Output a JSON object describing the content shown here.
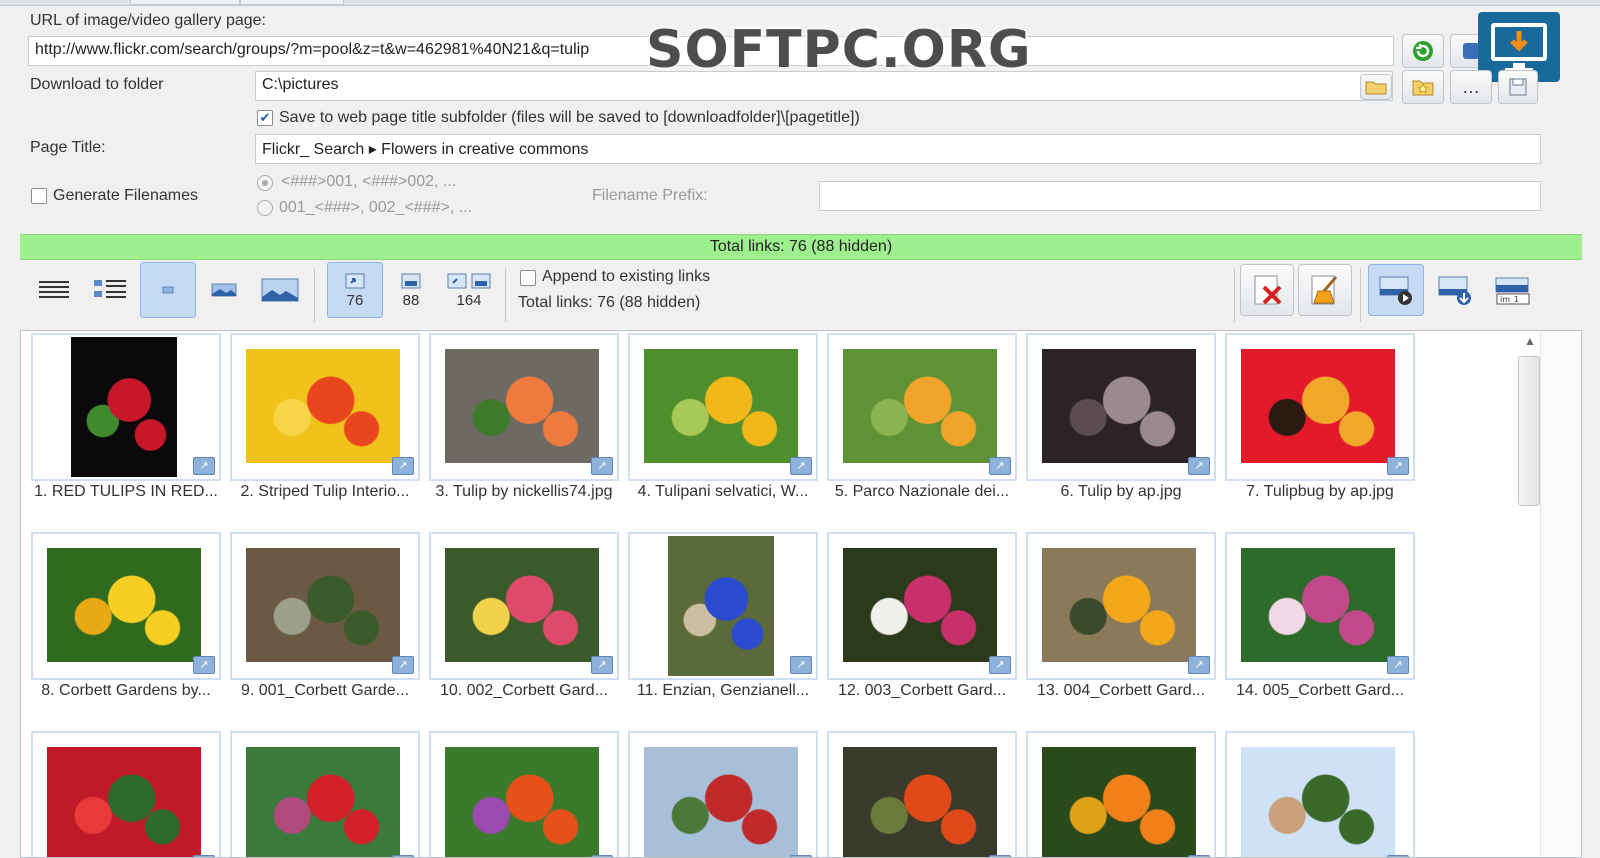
{
  "url": {
    "label": "URL of image/video gallery page:",
    "value": "http://www.flickr.com/search/groups/?m=pool&z=t&w=46298​1%40N21&q=tulip"
  },
  "folder": {
    "label": "Download to folder",
    "value": "C:\\pictures",
    "subfolder_label": "Save to web page title subfolder (files will be saved to [downloadfolder]\\[pagetitle])",
    "subfolder_checked": true
  },
  "page_title": {
    "label": "Page Title:",
    "value": "Flickr_ Search ▸ Flowers in creative commons"
  },
  "filenames": {
    "generate_label": "Generate Filenames",
    "pattern1": "<###>001, <###>002, ...",
    "pattern2": "001_<###>, 002_<###>, ...",
    "prefix_label": "Filename Prefix:",
    "prefix_value": ""
  },
  "status": {
    "total_text": "Total links: 76 (88 hidden)"
  },
  "toolbar": {
    "filter_counts": [
      "76",
      "88",
      "164"
    ],
    "append_label": "Append to existing links",
    "total_text": "Total links: 76 (88 hidden)"
  },
  "watermark": "SOFTPC.ORG",
  "gallery": [
    {
      "caption": "1. RED TULIPS IN RED...",
      "colors": [
        "#0a0a0a",
        "#c8162a",
        "#3f8a2e"
      ]
    },
    {
      "caption": "2. Striped Tulip Interio...",
      "colors": [
        "#f1c21b",
        "#e8471d",
        "#f7d64a"
      ]
    },
    {
      "caption": "3. Tulip by nickellis74.jpg",
      "colors": [
        "#6d6a63",
        "#ef7a3e",
        "#3d7a2a"
      ]
    },
    {
      "caption": "4. Tulipani selvatici, W...",
      "colors": [
        "#4e8e2c",
        "#f2b81a",
        "#a8c95a"
      ]
    },
    {
      "caption": "5. Parco Nazionale dei...",
      "colors": [
        "#5f9234",
        "#f0a52a",
        "#89b450"
      ]
    },
    {
      "caption": "6. Tulip by ap.jpg",
      "colors": [
        "#2c2424",
        "#9a8a90",
        "#5a4c52"
      ]
    },
    {
      "caption": "7. Tulipbug by ap.jpg",
      "colors": [
        "#e21a2a",
        "#f0a82a",
        "#2a1a12"
      ]
    },
    {
      "caption": "8. Corbett Gardens by...",
      "colors": [
        "#2f6a1e",
        "#f6cf22",
        "#e8a916"
      ]
    },
    {
      "caption": "9. 001_Corbett Garde...",
      "colors": [
        "#6a5a44",
        "#3a5a2a",
        "#9aa08a"
      ]
    },
    {
      "caption": "10. 002_Corbett Gard...",
      "colors": [
        "#3a5a2a",
        "#e04a6a",
        "#f2d24a"
      ]
    },
    {
      "caption": "11. Enzian, Genzianell...",
      "colors": [
        "#5a6a3a",
        "#2a4ad0",
        "#c8c0a0"
      ]
    },
    {
      "caption": "12. 003_Corbett Gard...",
      "colors": [
        "#2a3a1a",
        "#c8306a",
        "#f0f0ea"
      ]
    },
    {
      "caption": "13. 004_Corbett Gard...",
      "colors": [
        "#8a7a5a",
        "#f2a81a",
        "#3a4a2a"
      ]
    },
    {
      "caption": "14. 005_Corbett Gard...",
      "colors": [
        "#2e6a2a",
        "#c24a8a",
        "#f0d8e4"
      ]
    },
    {
      "caption": "",
      "colors": [
        "#c01a2a",
        "#2e6a2a",
        "#e83a3a"
      ]
    },
    {
      "caption": "",
      "colors": [
        "#3a7a3a",
        "#d4202a",
        "#b04a7a"
      ]
    },
    {
      "caption": "",
      "colors": [
        "#3a7a2a",
        "#e8501a",
        "#9a4ab0"
      ]
    },
    {
      "caption": "",
      "colors": [
        "#a8bfd8",
        "#c02a2a",
        "#4a7a3a"
      ]
    },
    {
      "caption": "",
      "colors": [
        "#3a3a2a",
        "#e04a1a",
        "#6a7a3a"
      ]
    },
    {
      "caption": "",
      "colors": [
        "#2a4a1a",
        "#f2801a",
        "#e0a01a"
      ]
    },
    {
      "caption": "",
      "colors": [
        "#cfe2f5",
        "#3a6a2a",
        "#c8a07a"
      ]
    }
  ]
}
